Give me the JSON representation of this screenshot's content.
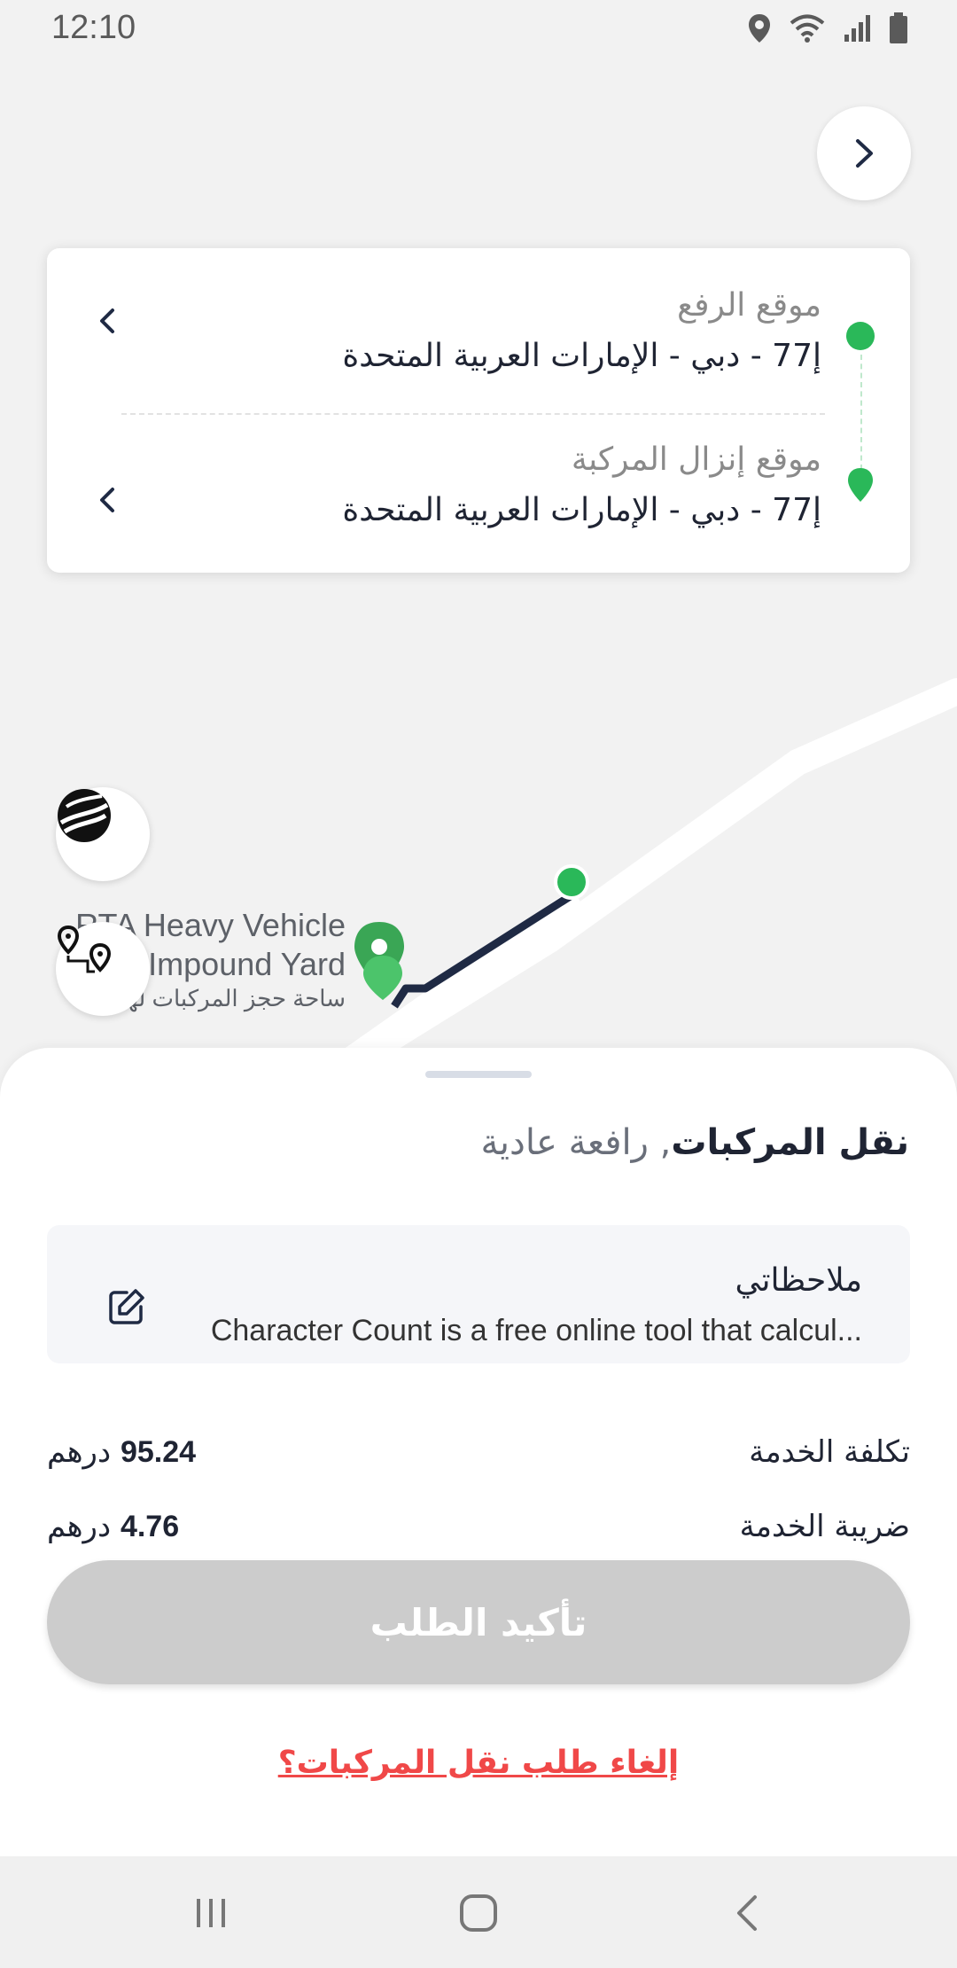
{
  "status": {
    "time": "12:10"
  },
  "locations": {
    "pickup_label": "موقع الرفع",
    "pickup_value": "إ77 - دبي - الإمارات العربية المتحدة",
    "dropoff_label": "موقع إنزال المركبة",
    "dropoff_value": "إ77 - دبي - الإمارات العربية المتحدة"
  },
  "map": {
    "place_name_en": "RTA Heavy Vehicle Impound Yard",
    "place_name_ar": "ساحة حجز المركبات لهي"
  },
  "service": {
    "title_bold": "نقل المركبات",
    "title_light": ", رافعة عادية"
  },
  "notes": {
    "title": "ملاحظاتي",
    "text": "Character Count is a free online tool that calcul..."
  },
  "fees": [
    {
      "label": "تكلفة الخدمة",
      "amount": "95.24",
      "currency": "درهم"
    },
    {
      "label": "ضريبة الخدمة",
      "amount": "4.76",
      "currency": "درهم"
    }
  ],
  "actions": {
    "confirm_label": "تأكيد الطلب",
    "cancel_label": "إلغاء طلب نقل المركبات؟"
  },
  "colors": {
    "accent_green": "#2ab859",
    "route_dark": "#1f2a44",
    "cancel_red": "#f04848",
    "disabled_button": "#cccccc"
  }
}
